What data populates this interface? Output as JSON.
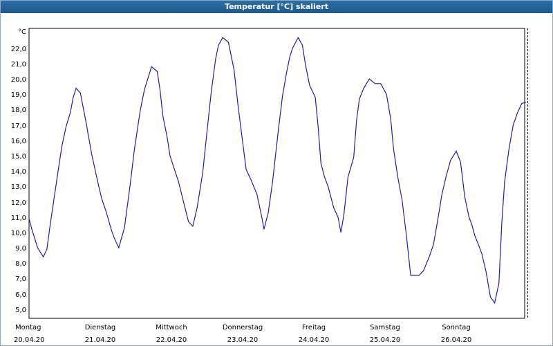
{
  "window": {
    "title": "Temperatur [°C] skaliert"
  },
  "colors": {
    "title_bar": "#1c5a8e",
    "line": "#1f1fa0",
    "grid": "#000000"
  },
  "chart_data": {
    "type": "line",
    "title": "Temperatur [°C] skaliert",
    "ylabel": "°C",
    "ylim": [
      4.4,
      23.3
    ],
    "yticks": [
      "22,0",
      "21,0",
      "20,0",
      "19,0",
      "18,0",
      "17,0",
      "16,0",
      "15,0",
      "14,0",
      "13,0",
      "12,0",
      "11,0",
      "10,0",
      "9,0",
      "8,0",
      "7,0",
      "6,0",
      "5,0"
    ],
    "ytick_values": [
      22,
      21,
      20,
      19,
      18,
      17,
      16,
      15,
      14,
      13,
      12,
      11,
      10,
      9,
      8,
      7,
      6,
      5
    ],
    "x_days": [
      {
        "day": "Montag",
        "date": "20.04.20"
      },
      {
        "day": "Dienstag",
        "date": "21.04.20"
      },
      {
        "day": "Mittwoch",
        "date": "22.04.20"
      },
      {
        "day": "Donnerstag",
        "date": "23.04.20"
      },
      {
        "day": "Freitag",
        "date": "24.04.20"
      },
      {
        "day": "Samstag",
        "date": "25.04.20"
      },
      {
        "day": "Sonntag",
        "date": "26.04.20"
      }
    ],
    "grid": true,
    "series": [
      {
        "x": [
          0,
          0.04,
          0.12,
          0.2,
          0.25,
          0.3,
          0.38,
          0.46,
          0.52,
          0.58,
          0.62,
          0.66,
          0.72,
          0.8,
          0.88,
          0.96,
          1.02,
          1.08,
          1.16,
          1.2,
          1.26,
          1.34,
          1.42,
          1.48,
          1.56,
          1.62,
          1.66,
          1.72,
          1.8,
          1.84,
          1.88,
          1.94,
          1.98,
          2.05,
          2.1,
          2.18,
          2.24,
          2.3,
          2.36,
          2.44,
          2.5,
          2.56,
          2.62,
          2.66,
          2.72,
          2.8,
          2.88,
          2.94,
          3.0,
          3.05,
          3.12,
          3.2,
          3.26,
          3.3,
          3.36,
          3.42,
          3.5,
          3.56,
          3.62,
          3.66,
          3.7,
          3.78,
          3.84,
          3.88,
          3.94,
          4.02,
          4.06,
          4.1,
          4.15,
          4.2,
          4.28,
          4.34,
          4.38,
          4.42,
          4.48,
          4.56,
          4.6,
          4.64,
          4.7,
          4.78,
          4.86,
          4.94,
          5.02,
          5.08,
          5.12,
          5.18,
          5.24,
          5.3,
          5.36,
          5.42,
          5.48,
          5.54,
          5.62,
          5.68,
          5.74,
          5.8,
          5.86,
          5.92,
          6.0,
          6.06,
          6.12,
          6.18,
          6.22,
          6.26,
          6.32,
          6.36,
          6.42,
          6.48,
          6.54,
          6.6,
          6.64,
          6.68,
          6.74,
          6.8,
          6.86,
          6.92,
          6.98
        ],
        "values": [
          10.9,
          10.2,
          9.0,
          8.4,
          8.9,
          10.6,
          13.1,
          15.6,
          16.9,
          17.8,
          18.8,
          19.4,
          19.1,
          17.2,
          15.1,
          13.4,
          12.2,
          11.4,
          10.1,
          9.6,
          9.0,
          10.3,
          13.1,
          15.4,
          17.9,
          19.3,
          19.9,
          20.8,
          20.5,
          19.3,
          17.6,
          16.2,
          15.0,
          14.0,
          13.3,
          11.8,
          10.7,
          10.4,
          11.6,
          13.9,
          16.6,
          19.2,
          21.3,
          22.2,
          22.7,
          22.4,
          20.6,
          18.1,
          15.9,
          14.1,
          13.4,
          12.5,
          11.2,
          10.2,
          11.3,
          13.3,
          16.6,
          18.9,
          20.5,
          21.4,
          22.0,
          22.7,
          22.2,
          21.0,
          19.6,
          18.8,
          16.9,
          14.5,
          13.6,
          13.0,
          11.6,
          11.0,
          10.0,
          11.1,
          13.6,
          14.9,
          17.3,
          18.7,
          19.4,
          20.0,
          19.7,
          19.7,
          19.0,
          17.4,
          15.4,
          13.6,
          12.1,
          9.8,
          7.2,
          7.2,
          7.2,
          7.5,
          8.4,
          9.2,
          10.8,
          12.5,
          13.7,
          14.7,
          15.3,
          14.6,
          12.3,
          11.0,
          10.5,
          9.8,
          9.1,
          8.6,
          7.4,
          5.8,
          5.4,
          6.7,
          10.6,
          13.3,
          15.4,
          17.0,
          17.8,
          18.4,
          18.5
        ]
      }
    ]
  }
}
